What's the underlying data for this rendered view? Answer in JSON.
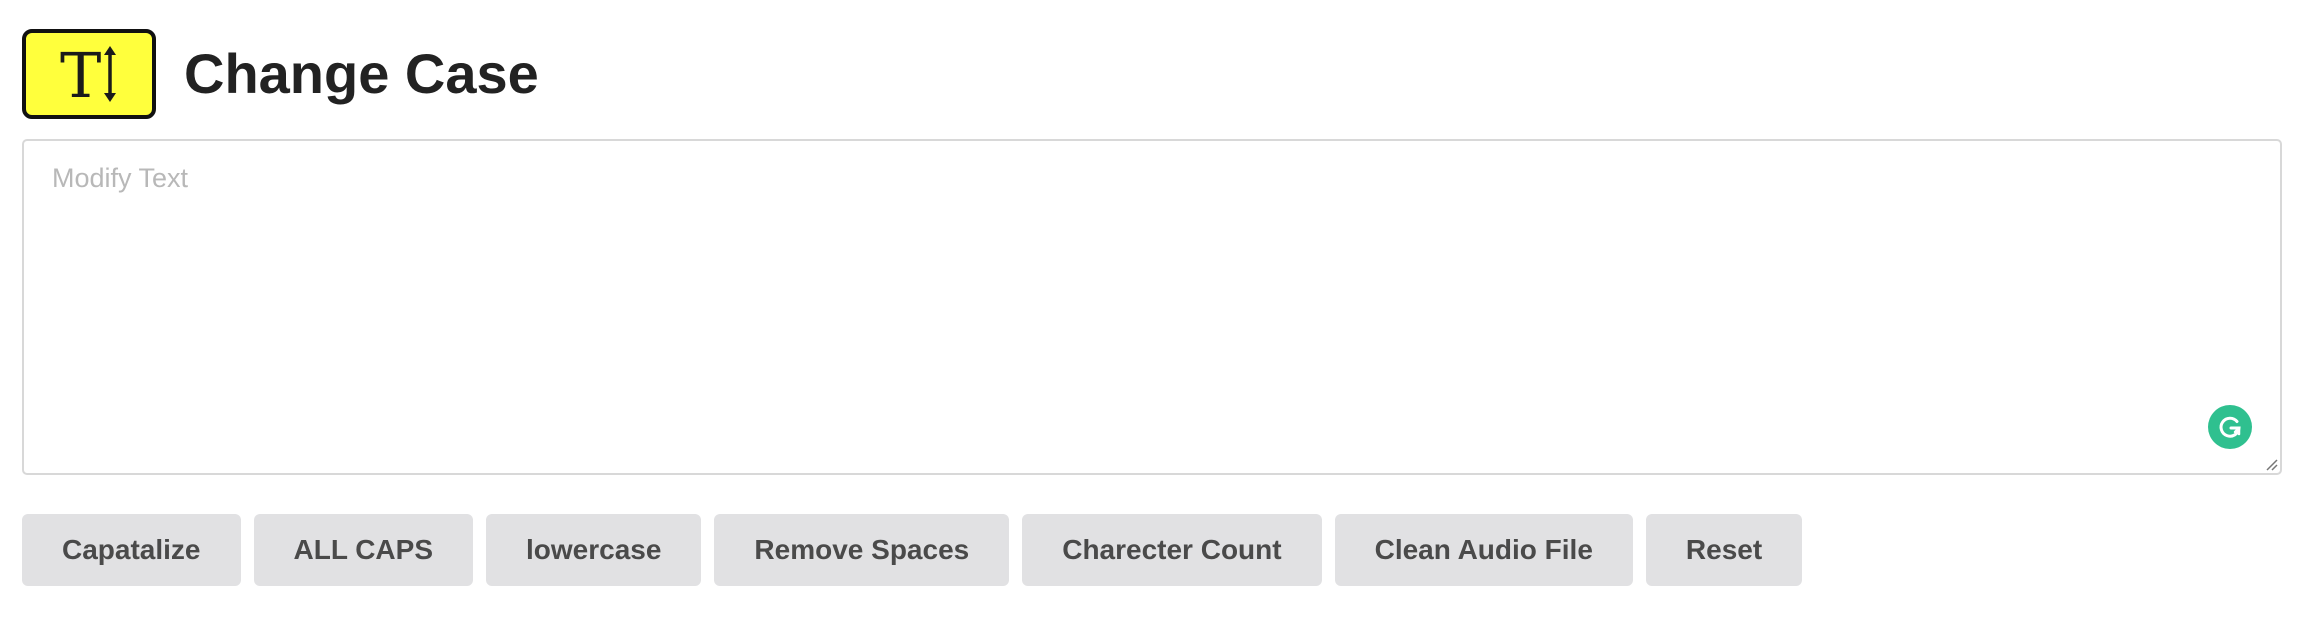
{
  "header": {
    "title": "Change Case",
    "logo_icon": "text-size-icon",
    "logo_glyph": "T",
    "logo_color": "#ffff3c"
  },
  "editor": {
    "placeholder": "Modify Text",
    "value": "",
    "badge_icon": "grammarly-icon"
  },
  "toolbar": {
    "buttons": [
      {
        "label": "Capatalize"
      },
      {
        "label": "ALL CAPS"
      },
      {
        "label": "lowercase"
      },
      {
        "label": "Remove Spaces"
      },
      {
        "label": "Charecter Count"
      },
      {
        "label": "Clean Audio File"
      },
      {
        "label": "Reset"
      }
    ],
    "button_bg": "#e1e1e3",
    "button_text_color": "#4a4a4a"
  }
}
